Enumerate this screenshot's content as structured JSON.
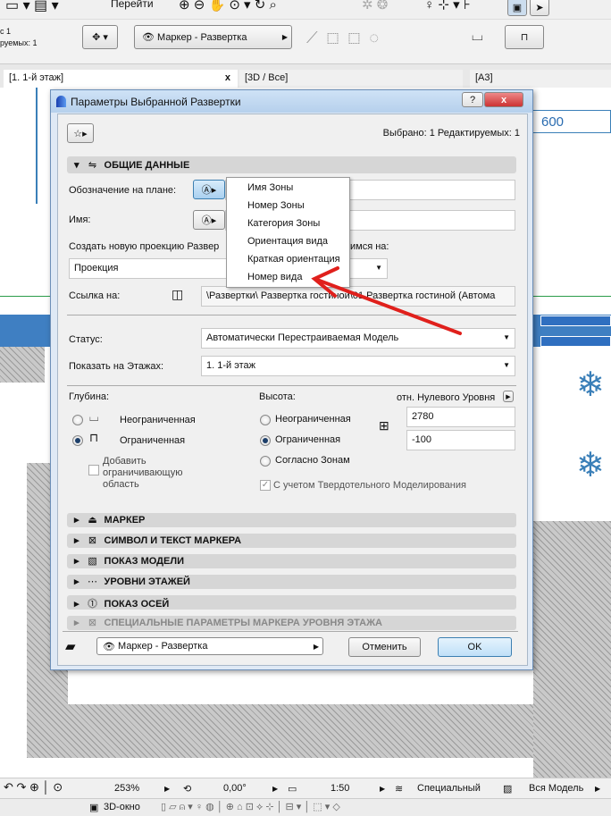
{
  "toolbar": {
    "goto": "Перейти",
    "sel_line1": "с 1",
    "sel_line2": "руемых: 1",
    "marker_select": "Маркер - Развертка"
  },
  "tabs": [
    {
      "label": "[1. 1-й этаж]",
      "close": "x"
    },
    {
      "label": "[3D / Все]"
    },
    {
      "label": "[A3]"
    }
  ],
  "canvas": {
    "dim": "600"
  },
  "dialog": {
    "title": "Параметры Выбранной Развертки",
    "help": "?",
    "close": "x",
    "selected_info": "Выбрано: 1 Редактируемых: 1",
    "general_section": "ОБЩИЕ ДАННЫЕ",
    "plan_label": "Обозначение на плане:",
    "name_label": "Имя:",
    "create_label_left": "Создать новую проекцию Развер",
    "create_label_right": "имся на:",
    "projection_value": "Проекция",
    "link_label": "Ссылка на:",
    "link_value": "\\Развертки\\  Развертка гостиной\\01 Развертка гостиной (Автома",
    "status_label": "Статус:",
    "status_value": "Автоматически Перестраиваемая Модель",
    "floors_label": "Показать на Этажах:",
    "floors_value": "1. 1-й этаж",
    "depth_label": "Глубина:",
    "depth_unlimited": "Неограниченная",
    "depth_limited": "Ограниченная",
    "add_area": "Добавить ограничивающую область",
    "height_label": "Высота:",
    "height_ref": "отн. Нулевого Уровня",
    "height_unlimited": "Неограниченная",
    "height_limited": "Ограниченная",
    "height_zones": "Согласно Зонам",
    "height_top": "2780",
    "height_bottom": "-100",
    "solid_modeling": "С учетом Твердотельного Моделирования",
    "sections": [
      "МАРКЕР",
      "СИМВОЛ И ТЕКСТ МАРКЕРА",
      "ПОКАЗ МОДЕЛИ",
      "УРОВНИ ЭТАЖЕЙ",
      "ПОКАЗ ОСЕЙ",
      "СПЕЦИАЛЬНЫЕ ПАРАМЕТРЫ МАРКЕРА УРОВНЯ ЭТАЖА"
    ],
    "footer_select": "Маркер - Развертка",
    "cancel": "Отменить",
    "ok": "OK"
  },
  "popup_menu": [
    "Имя Зоны",
    "Номер Зоны",
    "Категория Зоны",
    "Ориентация вида",
    "Краткая ориентация",
    "Номер вида"
  ],
  "statusbar": {
    "zoom": "253%",
    "angle": "0,00°",
    "scale": "1:50",
    "layer": "Специальный",
    "model": "Вся Модель"
  },
  "bottom": {
    "window3d": "3D-окно"
  },
  "colors": {
    "arrow": "#e0201c",
    "accent": "#3a7fb8"
  }
}
